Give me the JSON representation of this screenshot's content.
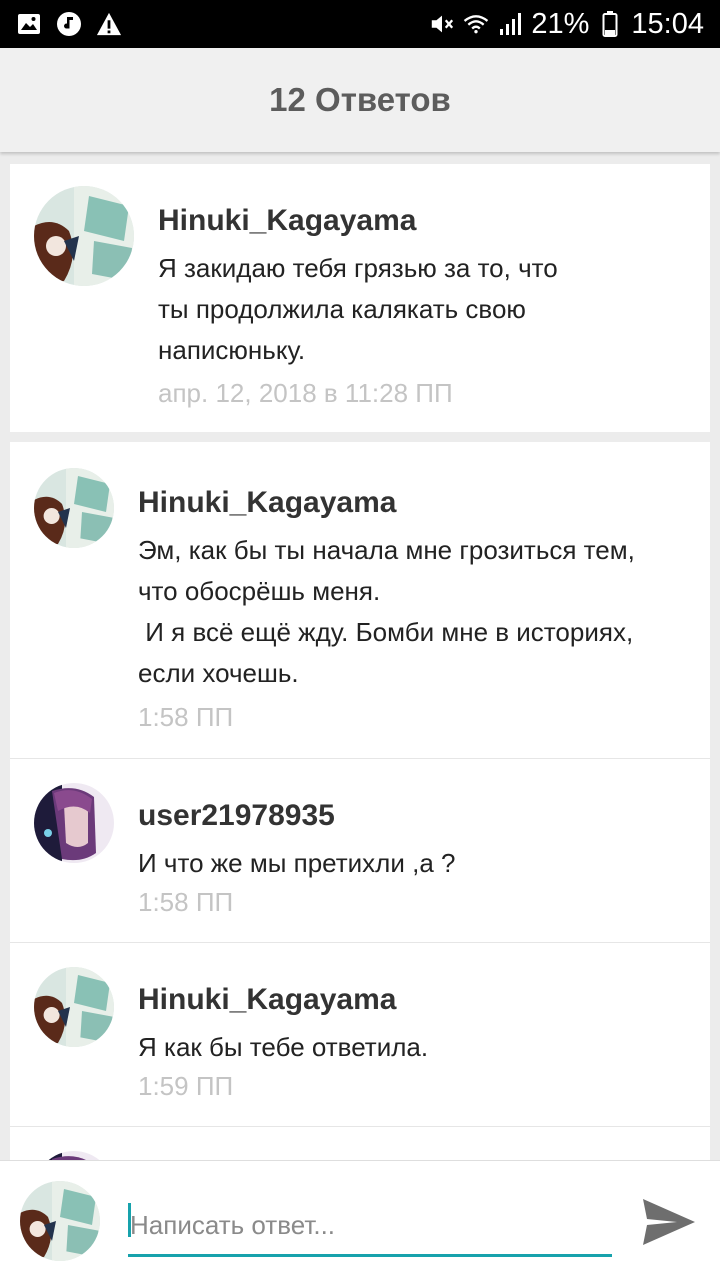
{
  "status_bar": {
    "battery": "21%",
    "time": "15:04",
    "icons": [
      "image-icon",
      "music-icon",
      "warning-icon",
      "mute-icon",
      "wifi-icon",
      "signal-icon",
      "battery-icon"
    ]
  },
  "header": {
    "title": "12 Ответов"
  },
  "parent_comment": {
    "author": "Hinuki_Kagayama",
    "lines": [
      "Я закидаю тебя грязью за то, что",
      "ты продолжила калякать свою",
      "написюньку."
    ],
    "time": "апр. 12, 2018 в 11:28 ПП"
  },
  "replies": [
    {
      "author": "Hinuki_Kagayama",
      "lines": [
        "Эм, как бы ты начала мне грозиться тем,",
        "что обосрёшь меня.",
        " И я всё ещё жду. Бомби мне в историях,",
        "если хочешь."
      ],
      "time": "1:58 ПП"
    },
    {
      "author": "user21978935",
      "lines": [
        "И что же мы претихли ,а ?"
      ],
      "time": "1:58 ПП"
    },
    {
      "author": "Hinuki_Kagayama",
      "lines": [
        "Я как бы тебе ответила."
      ],
      "time": "1:59 ПП"
    }
  ],
  "composer": {
    "placeholder": "Написать ответ..."
  },
  "colors": {
    "accent": "#17a2ac",
    "timestamp": "#c4c4c4",
    "title": "#5c5c5c"
  }
}
